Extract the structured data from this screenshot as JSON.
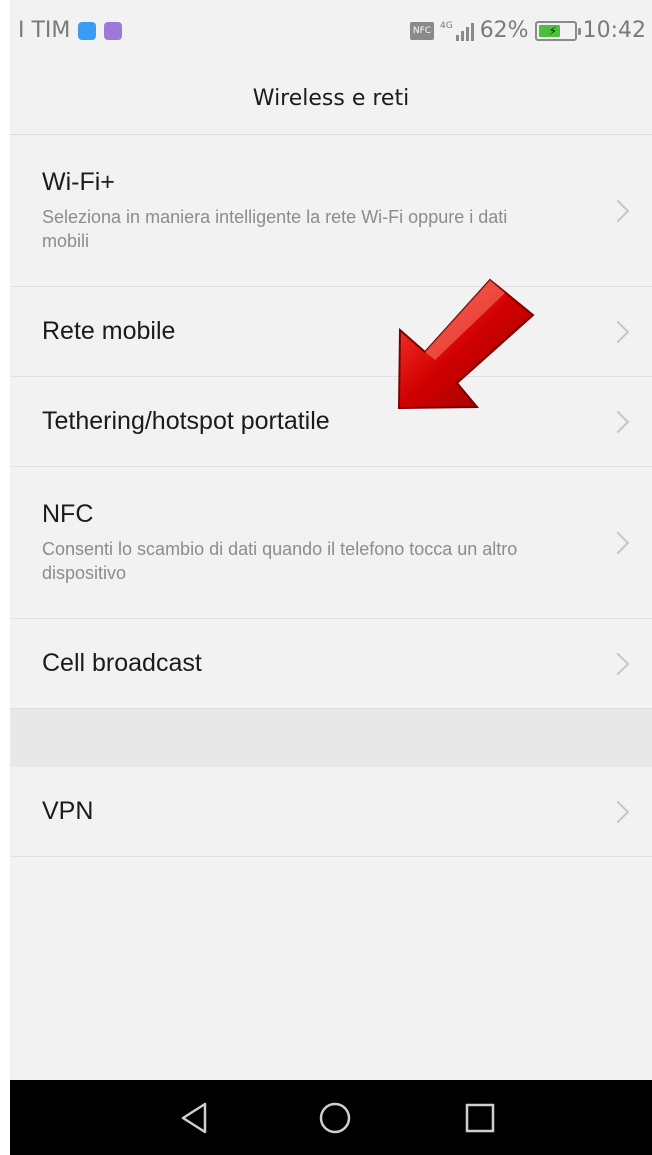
{
  "status_bar": {
    "carrier": "I TIM",
    "network": "4G",
    "battery_text": "62%",
    "battery_level": 0.62,
    "time": "10:42",
    "nfc_label": "NFC",
    "icons": [
      "bluetooth-app-icon",
      "viber-app-icon",
      "nfc-icon",
      "signal-icon",
      "battery-icon"
    ],
    "colors": {
      "battery": "#49c23a",
      "app1": "#3a9cf2",
      "app2": "#9b7ad8"
    }
  },
  "header": {
    "title": "Wireless e reti"
  },
  "items": [
    {
      "title": "Wi-Fi+",
      "subtitle": "Seleziona in maniera intelligente la rete Wi-Fi oppure i dati mobili"
    },
    {
      "title": "Rete mobile",
      "subtitle": ""
    },
    {
      "title": "Tethering/hotspot portatile",
      "subtitle": ""
    },
    {
      "title": "NFC",
      "subtitle": "Consenti lo scambio di dati quando il telefono tocca un altro dispositivo"
    },
    {
      "title": "Cell broadcast",
      "subtitle": ""
    },
    {
      "title": "VPN",
      "subtitle": ""
    }
  ],
  "annotation": {
    "icon": "red-arrow-icon",
    "points_to": "Tethering/hotspot portatile",
    "color": "#d10000"
  },
  "navbar": {
    "icons": [
      "back-icon",
      "home-icon",
      "recents-icon"
    ]
  }
}
